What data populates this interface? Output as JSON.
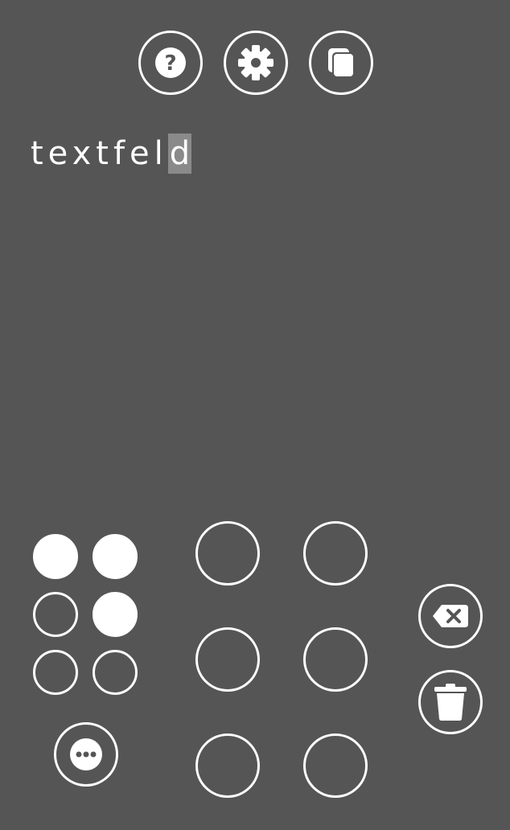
{
  "colors": {
    "background": "#555555",
    "foreground": "#ffffff",
    "cursor_highlight": "#8a8a8a"
  },
  "toolbar": {
    "help_icon": "question-icon",
    "settings_icon": "gear-icon",
    "copy_icon": "copy-icon"
  },
  "editor": {
    "text_before_cursor": "textfel",
    "cursor_char": "d"
  },
  "braille_cell": {
    "dots": [
      {
        "id": 1,
        "raised": true
      },
      {
        "id": 4,
        "raised": true
      },
      {
        "id": 2,
        "raised": false
      },
      {
        "id": 5,
        "raised": true
      },
      {
        "id": 3,
        "raised": false
      },
      {
        "id": 6,
        "raised": false
      }
    ]
  },
  "actions": {
    "more_icon": "more-icon",
    "backspace_icon": "backspace-icon",
    "clear_icon": "trash-icon"
  }
}
